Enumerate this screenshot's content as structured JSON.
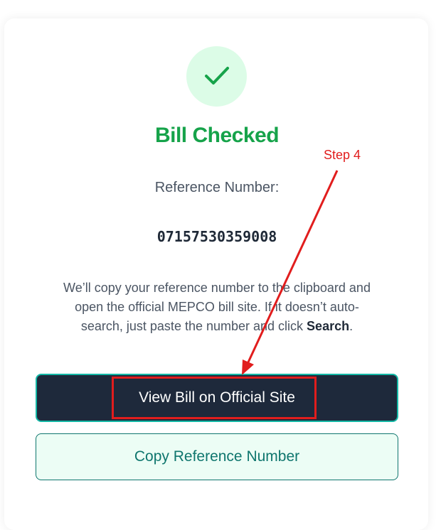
{
  "title": "Bill Checked",
  "reference_label": "Reference Number:",
  "reference_number": "07157530359008",
  "description": {
    "text": "We’ll copy your reference number to the clipboard and open the official MEPCO bill site. If it doesn’t auto-search, just paste the number and click ",
    "bold": "Search",
    "end": "."
  },
  "buttons": {
    "view_bill": "View Bill on Official Site",
    "copy_reference": "Copy Reference Number"
  },
  "annotation": {
    "step_label": "Step 4",
    "color": "#e11d1d"
  },
  "icons": {
    "status": "checkmark-icon"
  },
  "colors": {
    "success": "#16a34a",
    "primary_bg": "#1e293b",
    "accent": "#0f766e"
  }
}
